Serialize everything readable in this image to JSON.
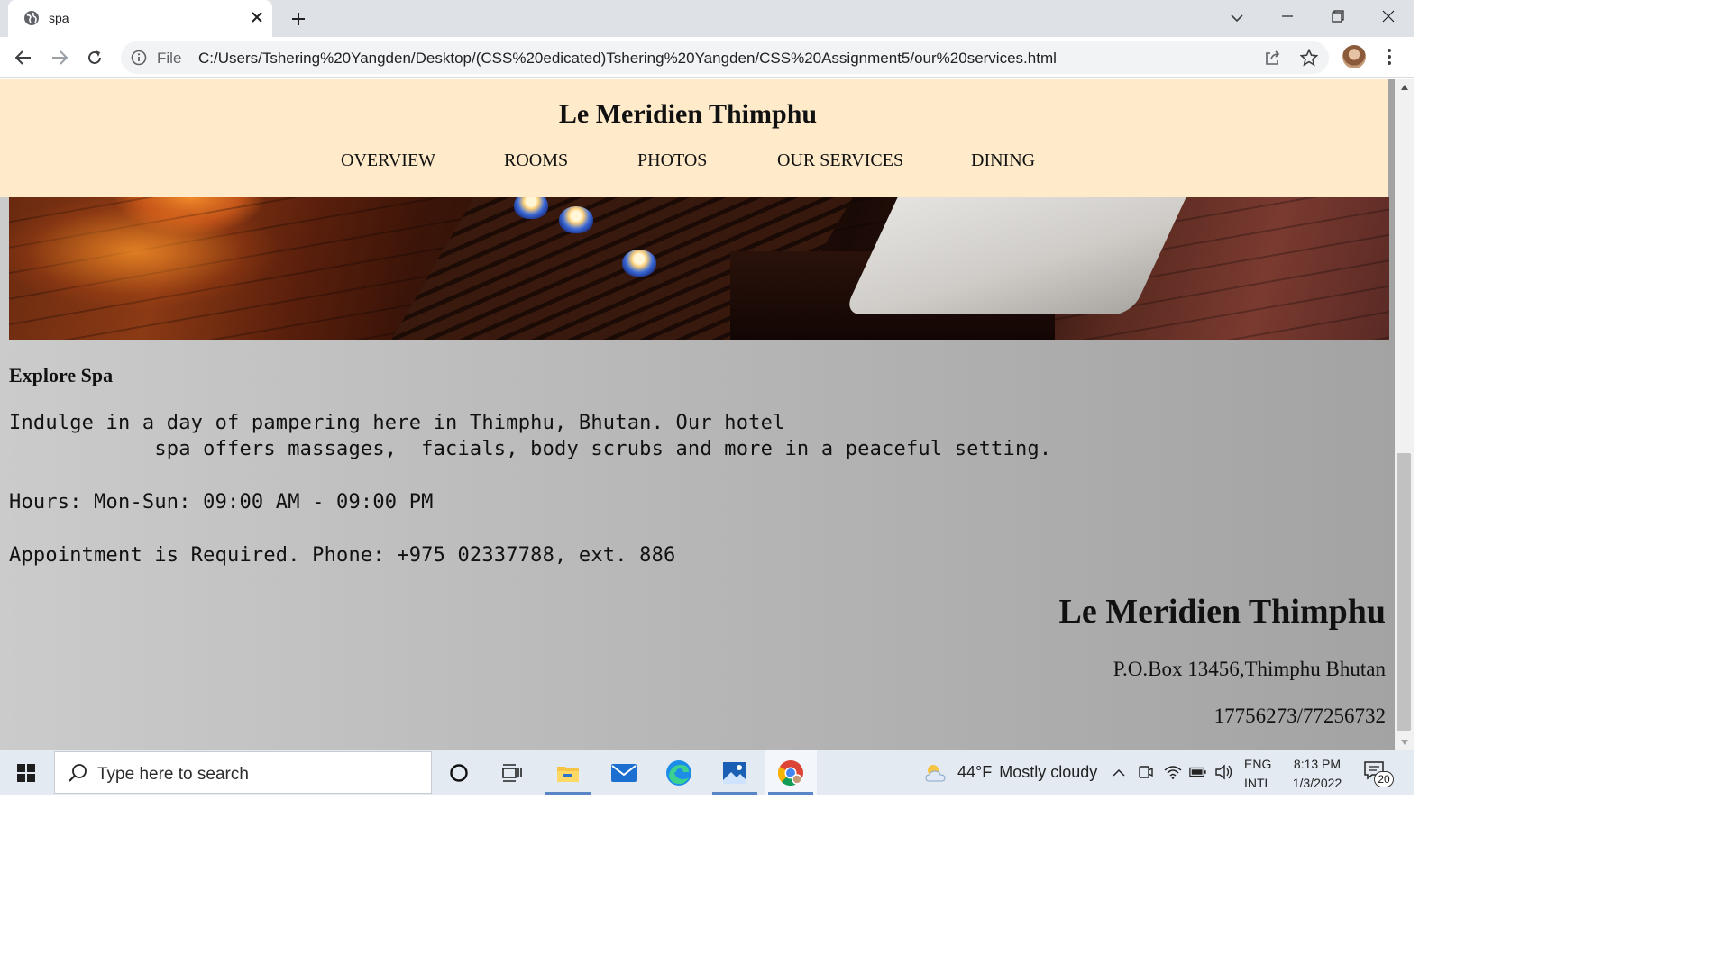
{
  "browser": {
    "tab_title": "spa",
    "omnibox_scheme": "File",
    "url": "C:/Users/Tshering%20Yangden/Desktop/(CSS%20edicated)Tshering%20Yangden/CSS%20Assignment5/our%20services.html"
  },
  "page": {
    "header": {
      "title": "Le Meridien Thimphu",
      "nav": [
        "OVERVIEW",
        "ROOMS",
        "PHOTOS",
        "OUR SERVICES",
        "DINING"
      ]
    },
    "section": {
      "heading": "Explore Spa",
      "lines": [
        "Indulge in a day of pampering here in Thimphu, Bhutan. Our hotel",
        "            spa offers massages,  facials, body scrubs and more in a peaceful setting.",
        "Hours: Mon-Sun: 09:00 AM - 09:00 PM",
        "Appointment is Required. Phone: +975 02337788, ext. 886"
      ]
    },
    "footer": {
      "title": "Le Meridien Thimphu",
      "address": "P.O.Box 13456,Thimphu Bhutan",
      "phone": "17756273/77256732"
    },
    "colors": {
      "header_bg": "#ffebca",
      "page_bg": "#b8b8b8"
    }
  },
  "taskbar": {
    "search_placeholder": "Type here to search",
    "weather_temp": "44°F",
    "weather_desc": "Mostly cloudy",
    "lang_top": "ENG",
    "lang_bottom": "INTL",
    "time": "8:13 PM",
    "date": "1/3/2022",
    "notification_count": "20"
  }
}
